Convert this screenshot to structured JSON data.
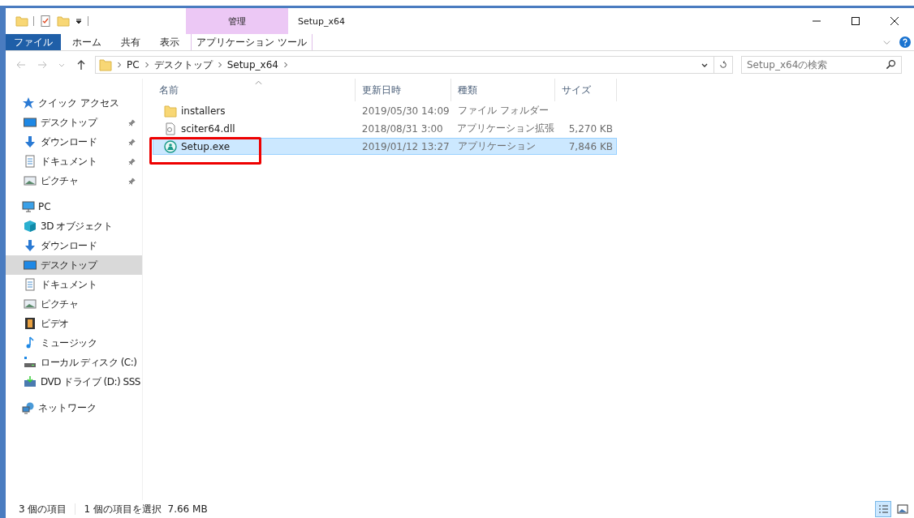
{
  "window": {
    "title": "Setup_x64",
    "context_tab_group": "管理"
  },
  "ribbon_tabs": [
    {
      "label": "ファイル",
      "selected": true,
      "kind": "file"
    },
    {
      "label": "ホーム",
      "selected": false,
      "kind": "normal"
    },
    {
      "label": "共有",
      "selected": false,
      "kind": "normal"
    },
    {
      "label": "表示",
      "selected": false,
      "kind": "normal"
    },
    {
      "label": "アプリケーション ツール",
      "selected": false,
      "kind": "context"
    }
  ],
  "breadcrumb": [
    "PC",
    "デスクトップ",
    "Setup_x64"
  ],
  "search": {
    "placeholder": "Setup_x64の検索"
  },
  "sidebar": {
    "items": [
      {
        "label": "クイック アクセス",
        "kind": "star",
        "selected": false,
        "children": [
          {
            "label": "デスクトップ",
            "kind": "desktop",
            "pinned": true,
            "selected": false
          },
          {
            "label": "ダウンロード",
            "kind": "download",
            "pinned": true,
            "selected": false
          },
          {
            "label": "ドキュメント",
            "kind": "document",
            "pinned": true,
            "selected": false
          },
          {
            "label": "ピクチャ",
            "kind": "picture",
            "pinned": true,
            "selected": false
          }
        ]
      },
      {
        "label": "PC",
        "kind": "pc",
        "selected": false,
        "children": [
          {
            "label": "3D オブジェクト",
            "kind": "cube",
            "selected": false
          },
          {
            "label": "ダウンロード",
            "kind": "download",
            "selected": false
          },
          {
            "label": "デスクトップ",
            "kind": "desktop",
            "selected": true
          },
          {
            "label": "ドキュメント",
            "kind": "document",
            "selected": false
          },
          {
            "label": "ピクチャ",
            "kind": "picture",
            "selected": false
          },
          {
            "label": "ビデオ",
            "kind": "video",
            "selected": false
          },
          {
            "label": "ミュージック",
            "kind": "music",
            "selected": false
          },
          {
            "label": "ローカル ディスク (C:)",
            "kind": "disk",
            "selected": false
          },
          {
            "label": "DVD ドライブ (D:) SSS",
            "kind": "dvd",
            "selected": false
          }
        ]
      },
      {
        "label": "ネットワーク",
        "kind": "network",
        "selected": false
      }
    ]
  },
  "table": {
    "columns": [
      "名前",
      "更新日時",
      "種類",
      "サイズ"
    ],
    "rows": [
      {
        "name": "installers",
        "kind": "folder",
        "modified": "2019/05/30 14:09",
        "type": "ファイル フォルダー",
        "selected": false,
        "highlighted": false
      },
      {
        "name": "sciter64.dll",
        "kind": "dll",
        "modified": "2018/08/31 3:00",
        "type": "アプリケーション拡張",
        "size": "5,270 KB",
        "selected": false,
        "highlighted": false
      },
      {
        "name": "Setup.exe",
        "kind": "exe",
        "modified": "2019/01/12 13:27",
        "type": "アプリケーション",
        "size": "7,846 KB",
        "selected": true,
        "highlighted": true
      }
    ]
  },
  "status_bar": {
    "item_count": "3 個の項目",
    "selection": "1 個の項目を選択  7.66 MB"
  }
}
